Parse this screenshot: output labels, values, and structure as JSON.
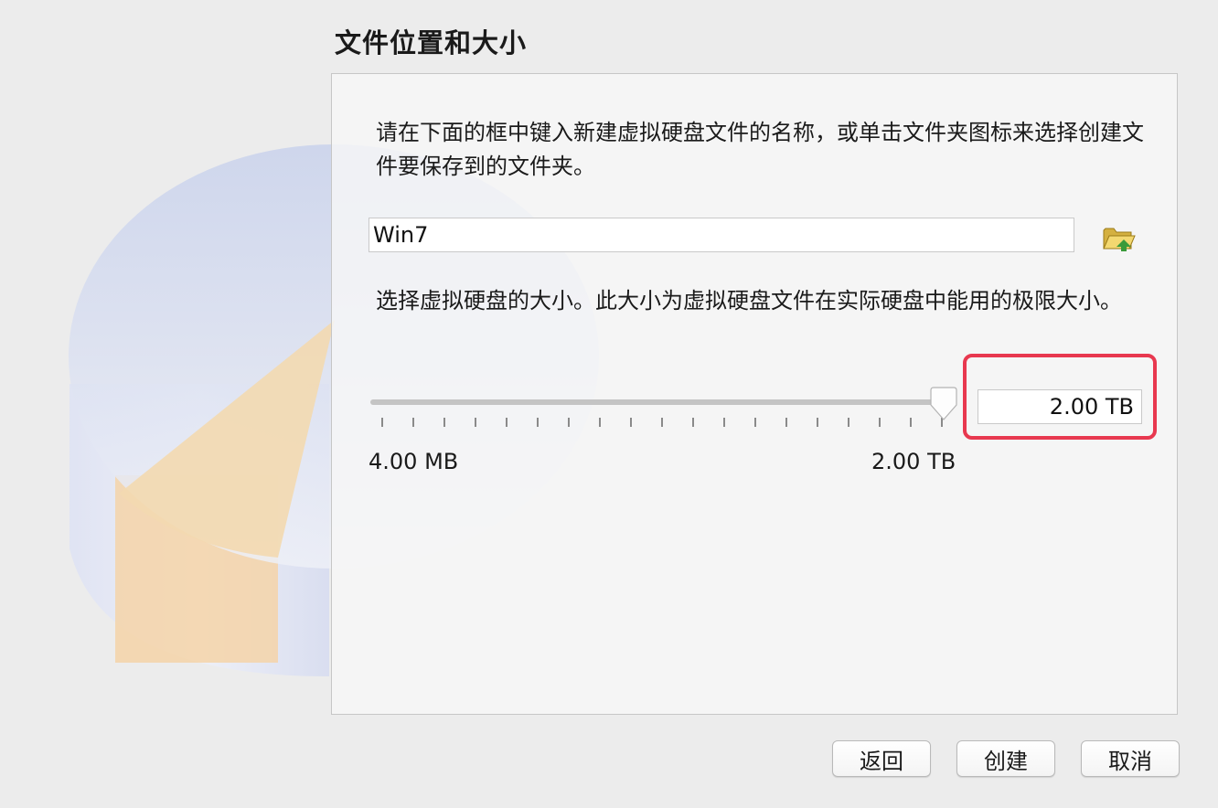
{
  "page": {
    "title": "文件位置和大小"
  },
  "location": {
    "description": "请在下面的框中键入新建虚拟硬盘文件的名称，或单击文件夹图标来选择创建文件要保存到的文件夹。",
    "file_name": "Win7",
    "folder_icon": "folder-open-icon"
  },
  "size": {
    "description": "选择虚拟硬盘的大小。此大小为虚拟硬盘文件在实际硬盘中能用的极限大小。",
    "value": "2.00 TB",
    "slider_fraction": 1.0,
    "min_label": "4.00 MB",
    "max_label": "2.00 TB"
  },
  "buttons": {
    "back": "返回",
    "create": "创建",
    "cancel": "取消"
  },
  "colors": {
    "highlight": "#e8384f"
  }
}
